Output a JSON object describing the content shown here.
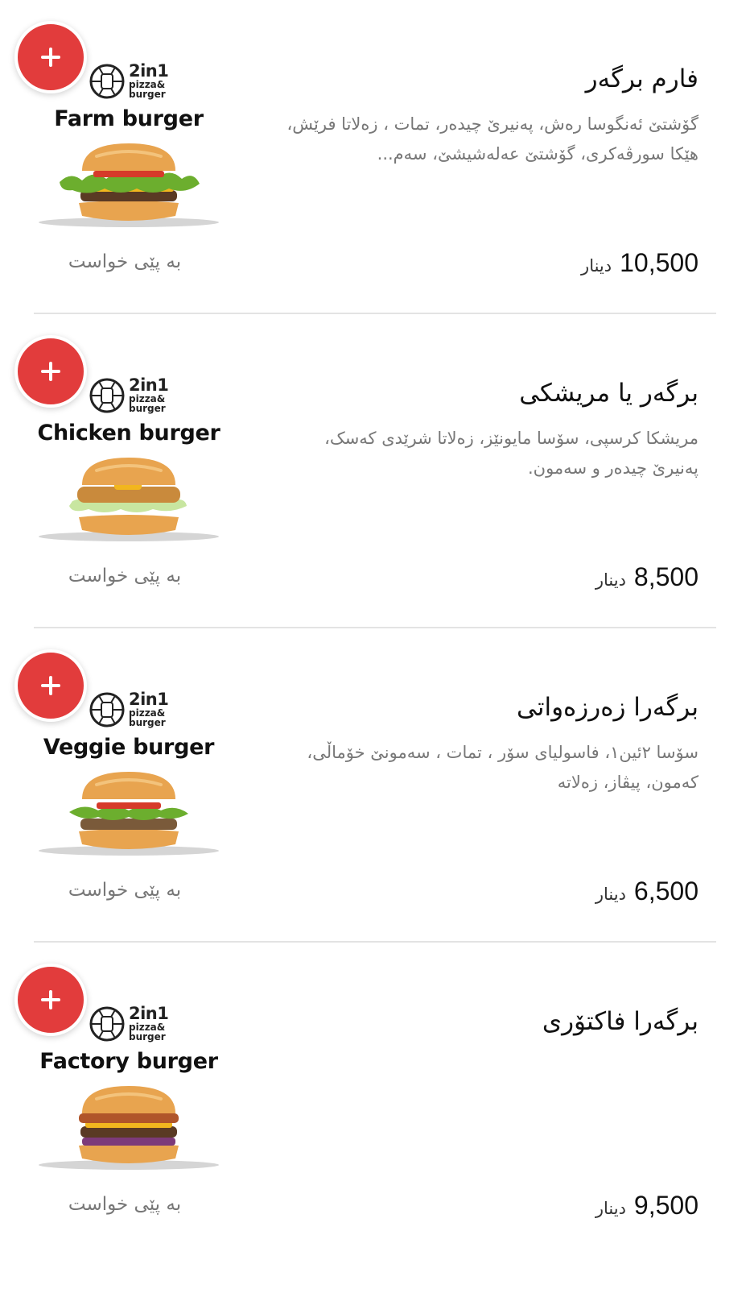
{
  "items": [
    {
      "title": "فارم برگەر",
      "description": "گۆشتێ ئەنگوسا رەش، پەنیرێ چیدەر، تمات ، زەلاتا فرێش، هێکا سورڤەکری، گۆشتێ عەلەشیشێ، سەم...",
      "price": "10,500",
      "currency": "دینار",
      "image_label": "Farm burger",
      "on_demand": "بە پێی خواست",
      "burger_style": "farm"
    },
    {
      "title": "برگەر یا مریشکی",
      "description": "مریشکا کرسپی، سۆسا مایونێز، زەلاتا شرێدی کەسک، پەنیرێ چیدەر و سەمون.",
      "price": "8,500",
      "currency": "دینار",
      "image_label": "Chicken burger",
      "on_demand": "بە پێی خواست",
      "burger_style": "chicken"
    },
    {
      "title": "برگەرا زەرزەواتی",
      "description": "سۆسا ٢ئین١، فاسولیای سۆر ، تمات ، سەمونێ خۆماڵی، کەمون، پیڤاز، زەلاتە",
      "price": "6,500",
      "currency": "دینار",
      "image_label": "Veggie burger",
      "on_demand": "بە پێی خواست",
      "burger_style": "veggie"
    },
    {
      "title": "برگەرا فاکتۆری",
      "description": "",
      "price": "9,500",
      "currency": "دینار",
      "image_label": "Factory burger",
      "on_demand": "بە پێی خواست",
      "burger_style": "factory"
    }
  ],
  "logo": {
    "main": "2in1",
    "sub1": "pizza&",
    "sub2": "burger"
  },
  "colors": {
    "accent": "#e23c3c",
    "muted_text": "#777777",
    "divider": "#e3e3e3",
    "bun": "#e8a44f",
    "lettuce": "#6cae2e",
    "tomato": "#d63a2a",
    "patty": "#5a3a24",
    "cheese": "#f2b61e",
    "fried_chicken": "#c98a3c",
    "cabbage": "#7d3a7a"
  }
}
